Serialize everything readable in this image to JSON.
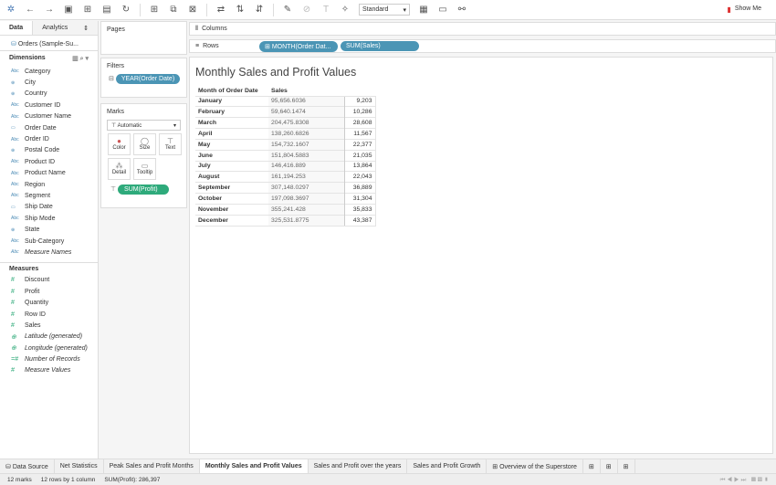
{
  "toolbar": {
    "icons": [
      "tableau-logo-icon",
      "undo-icon",
      "redo-icon",
      "save-icon",
      "new-datasource-icon",
      "pause-icon",
      "refresh-icon",
      "new-worksheet-icon",
      "duplicate-icon",
      "clear-icon",
      "swap-icon",
      "sort-asc-icon",
      "sort-desc-icon",
      "highlight-icon",
      "paperclip-icon",
      "label-icon",
      "pin-icon"
    ],
    "fit": "Standard",
    "show_me": "Show Me"
  },
  "left": {
    "tab_data": "Data",
    "tab_analytics": "Analytics",
    "source": "Orders (Sample-Su...",
    "dimensions_label": "Dimensions",
    "dimensions": [
      {
        "icon": "Abc",
        "name": "Category"
      },
      {
        "icon": "⊕",
        "name": "City"
      },
      {
        "icon": "⊕",
        "name": "Country"
      },
      {
        "icon": "Abc",
        "name": "Customer ID"
      },
      {
        "icon": "Abc",
        "name": "Customer Name"
      },
      {
        "icon": "▭",
        "name": "Order Date"
      },
      {
        "icon": "Abc",
        "name": "Order ID"
      },
      {
        "icon": "⊕",
        "name": "Postal Code"
      },
      {
        "icon": "Abc",
        "name": "Product ID"
      },
      {
        "icon": "Abc",
        "name": "Product Name"
      },
      {
        "icon": "Abc",
        "name": "Region"
      },
      {
        "icon": "Abc",
        "name": "Segment"
      },
      {
        "icon": "▭",
        "name": "Ship Date"
      },
      {
        "icon": "Abc",
        "name": "Ship Mode"
      },
      {
        "icon": "⊕",
        "name": "State"
      },
      {
        "icon": "Abc",
        "name": "Sub-Category"
      },
      {
        "icon": "Abc",
        "name": "Measure Names",
        "italic": true
      }
    ],
    "measures_label": "Measures",
    "measures": [
      {
        "icon": "#",
        "name": "Discount"
      },
      {
        "icon": "#",
        "name": "Profit"
      },
      {
        "icon": "#",
        "name": "Quantity"
      },
      {
        "icon": "#",
        "name": "Row ID"
      },
      {
        "icon": "#",
        "name": "Sales"
      },
      {
        "icon": "⊕",
        "name": "Latitude (generated)",
        "italic": true
      },
      {
        "icon": "⊕",
        "name": "Longitude (generated)",
        "italic": true
      },
      {
        "icon": "=#",
        "name": "Number of Records",
        "italic": true
      },
      {
        "icon": "#",
        "name": "Measure Values",
        "italic": true
      }
    ]
  },
  "pages": {
    "label": "Pages"
  },
  "filters": {
    "label": "Filters",
    "pill": "YEAR(Order Date)"
  },
  "marks": {
    "label": "Marks",
    "type": "Automatic",
    "buttons": [
      "Color",
      "Size",
      "Text",
      "Detail",
      "Tooltip"
    ],
    "pill": "SUM(Profit)"
  },
  "columns": {
    "label": "Columns"
  },
  "rows": {
    "label": "Rows",
    "pills": [
      "MONTH(Order Dat...",
      "SUM(Sales)"
    ]
  },
  "view": {
    "title": "Monthly Sales and Profit Values",
    "headers": [
      "Month of Order Date",
      "Sales"
    ],
    "rows": [
      [
        "January",
        "95,656.6036",
        "9,203"
      ],
      [
        "February",
        "59,640.1474",
        "10,286"
      ],
      [
        "March",
        "204,475.8308",
        "28,608"
      ],
      [
        "April",
        "138,260.6826",
        "11,567"
      ],
      [
        "May",
        "154,732.1607",
        "22,377"
      ],
      [
        "June",
        "151,804.5883",
        "21,035"
      ],
      [
        "July",
        "146,416.889",
        "13,864"
      ],
      [
        "August",
        "161,194.253",
        "22,043"
      ],
      [
        "September",
        "307,148.0297",
        "36,889"
      ],
      [
        "October",
        "197,098.3697",
        "31,304"
      ],
      [
        "November",
        "355,241.428",
        "35,833"
      ],
      [
        "December",
        "325,531.8775",
        "43,387"
      ]
    ]
  },
  "tabs": [
    "Data Source",
    "Net Statistics",
    "Peak Sales and Profit Months",
    "Monthly Sales and Profit Values",
    "Sales and Profit over the years",
    "Sales and Profit Growth",
    "Overview of the Superstore"
  ],
  "active_tab": "Monthly Sales and Profit Values",
  "status": {
    "marks": "12 marks",
    "rows": "12 rows by 1 column",
    "sum": "SUM(Profit): 286,397"
  },
  "colors": {
    "pill_blue": "#4b95b5",
    "pill_green": "#2eaa7b"
  }
}
